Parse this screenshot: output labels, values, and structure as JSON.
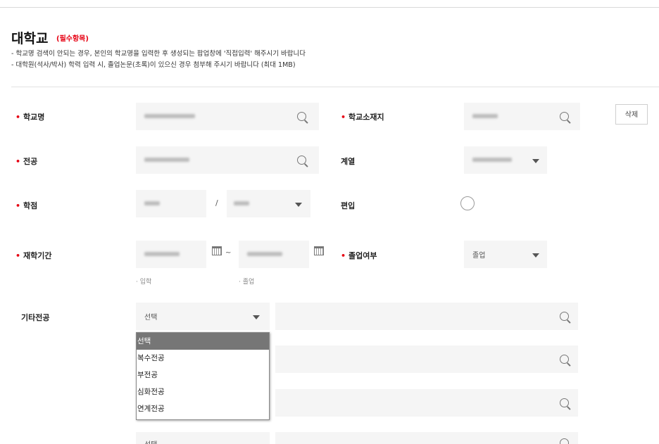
{
  "header": {
    "title": "대학교",
    "required_note": "(필수항목)",
    "notes": [
      "- 학교명 검색이 안되는 경우, 본인의 학교명을 입력한 후 생성되는 팝업창에 '직접입력' 해주시기 바랍니다",
      "- 대학원(석사/박사) 학력 입력 시, 졸업논문(초록)이 있으신 경우 첨부해 주시기 바랍니다 (최대 1MB)"
    ]
  },
  "form": {
    "required_mark": "•",
    "school_name_label": "학교명",
    "school_location_label": "학교소재지",
    "delete_label": "삭제",
    "major_label": "전공",
    "category_label": "계열",
    "gpa_label": "학점",
    "gpa_separator": "/",
    "transfer_label": "편입",
    "period_label": "재학기간",
    "period_separator": "~",
    "admission_label": "입학",
    "graduation_label": "졸업",
    "graduation_status_label": "졸업여부",
    "graduation_status_value": "졸업",
    "other_major_label": "기타전공",
    "other_major_select_value": "선택",
    "last_select_value": "선택"
  },
  "dropdown": {
    "options": [
      "선택",
      "복수전공",
      "부전공",
      "심화전공",
      "연계전공"
    ],
    "selected_index": 0
  },
  "icons": {
    "search": "search-icon",
    "calendar": "calendar-icon",
    "caret": "caret-down-icon"
  },
  "colors": {
    "accent": "#e60012",
    "field_bg": "#f5f5f5",
    "dropdown_selected_bg": "#767676"
  }
}
